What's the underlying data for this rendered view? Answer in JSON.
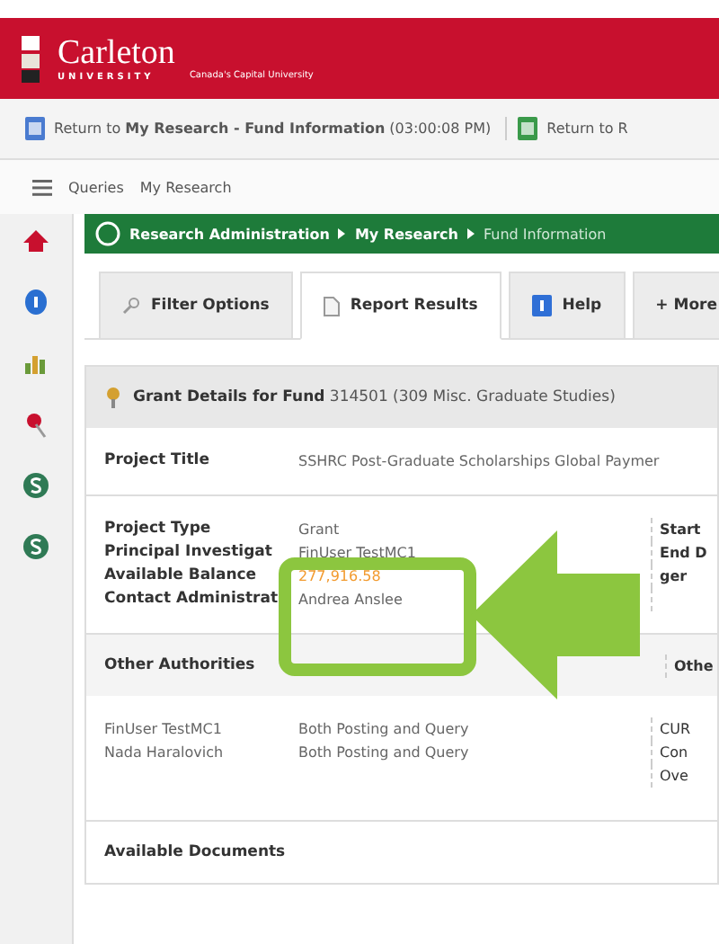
{
  "header": {
    "logo": "Carleton",
    "logo_sub": "UNIVERSITY",
    "tagline": "Canada's Capital University"
  },
  "toolbar": [
    {
      "text": "Return to **My Research - Fund Information** (03:00:08 PM)"
    },
    {
      "text": "Return to R"
    }
  ],
  "menu": [
    "Queries",
    "My Research"
  ],
  "sidebar": [
    {
      "kind": "home"
    },
    {
      "kind": "info"
    },
    {
      "kind": "chart"
    },
    {
      "kind": "pin"
    },
    {
      "kind": "dollar"
    },
    {
      "kind": "dollar"
    }
  ],
  "breadcrumb": [
    "Research Administration",
    "My Research",
    "Fund Information"
  ],
  "tabs": [
    {
      "label": "Filter Options",
      "selected": false
    },
    {
      "label": "Report Results",
      "selected": true
    },
    {
      "label": "Help",
      "selected": false
    },
    {
      "label": "+ More",
      "selected": false
    }
  ],
  "grant_title": "**Grant Details for Fund** 314501 (309 Misc. Graduate Studies)",
  "project_title": {
    "label": "Project Title",
    "value": "SSHRC Post-Graduate Scholarships Global Paymer"
  },
  "details": [
    {
      "label": "Project Type",
      "value": "Grant",
      "side": "Start"
    },
    {
      "label": "Principal Investigat",
      "value": "FinUser TestMC1",
      "side": "End D"
    },
    {
      "label": "Available Balance",
      "value": "277,916.58",
      "highlight": true,
      "side": "ger"
    },
    {
      "label": "Contact Administrat",
      "value": "Andrea Anslee"
    }
  ],
  "other_authorities": {
    "title": "Other Authorities",
    "side_title": "Othe",
    "rows": [
      {
        "name": "FinUser TestMC1",
        "access": "Both Posting and Query",
        "side": "CUR"
      },
      {
        "name": "Nada Haralovich",
        "access": "Both Posting and Query",
        "side": "Con"
      },
      {
        "side": "Ove"
      }
    ]
  },
  "documents_title": "Available Documents"
}
